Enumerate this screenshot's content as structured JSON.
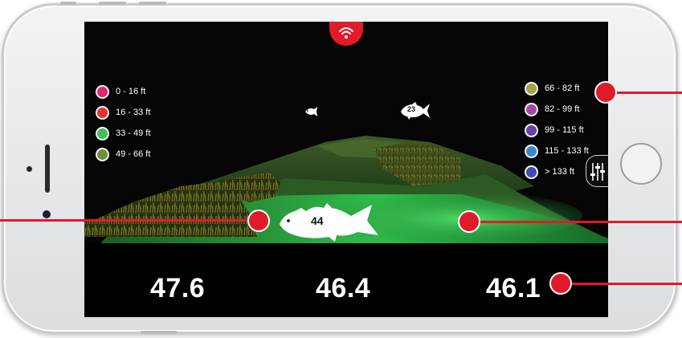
{
  "app": {
    "connection_icon": "wifi-icon",
    "accent_color": "#e21b2b"
  },
  "legend_left": [
    {
      "label": "0 - 16 ft",
      "color": "#e8246e"
    },
    {
      "label": "16 - 33 ft",
      "color": "#e8322c"
    },
    {
      "label": "33 - 49 ft",
      "color": "#3cc25a"
    },
    {
      "label": "49 - 66 ft",
      "color": "#6f8f3d"
    }
  ],
  "legend_right": [
    {
      "label": "66 - 82 ft",
      "color": "#a2a247"
    },
    {
      "label": "82 - 99 ft",
      "color": "#a24aa5"
    },
    {
      "label": "99 - 115 ft",
      "color": "#6a3fb0"
    },
    {
      "label": "115 - 133 ft",
      "color": "#3a86d4"
    },
    {
      "label": "> 133 ft",
      "color": "#3f48b4"
    }
  ],
  "fish": [
    {
      "label": "44"
    },
    {
      "label": "23"
    }
  ],
  "controls": {
    "filter_icon": "sliders-icon"
  },
  "readings": {
    "left": "47.6",
    "center": "46.4",
    "right": "46.1"
  }
}
